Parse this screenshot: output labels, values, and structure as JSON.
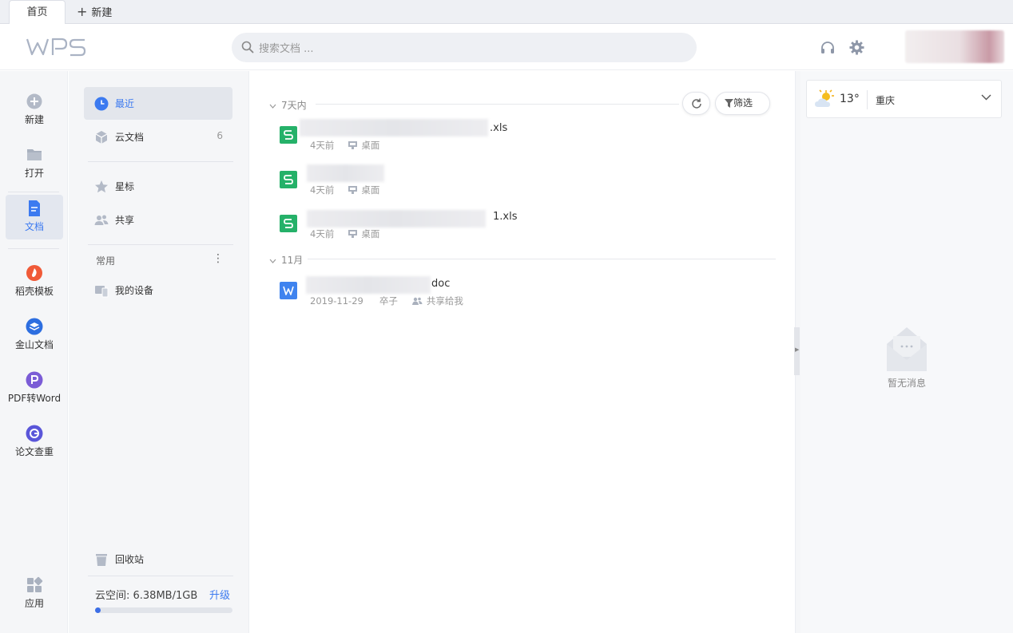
{
  "tabs": {
    "home": "首页",
    "new": "新建"
  },
  "search": {
    "placeholder": "搜索文档 ..."
  },
  "leftnav": {
    "new": "新建",
    "open": "打开",
    "docs": "文档",
    "template": "稻壳模板",
    "kdocs": "金山文档",
    "pdf2word": "PDF转Word",
    "paper_check": "论文查重",
    "apps": "应用"
  },
  "sidebar": {
    "recent": "最近",
    "cloud_docs": "云文档",
    "cloud_docs_count": "6",
    "starred": "星标",
    "shared": "共享",
    "section_common": "常用",
    "my_devices": "我的设备",
    "recycle": "回收站",
    "storage_label": "云空间: 6.38MB/1GB",
    "storage_used_fraction": 0.006,
    "upgrade": "升级"
  },
  "main": {
    "group_recent": "7天内",
    "group_nov": "11月",
    "filter": "筛选",
    "files": [
      {
        "name_suffix": ".xls",
        "time": "4天前",
        "location": "桌面",
        "type": "et"
      },
      {
        "name_suffix": "",
        "time": "4天前",
        "location": "桌面",
        "type": "et"
      },
      {
        "name_suffix": "1.xls",
        "time": "4天前",
        "location": "桌面",
        "type": "et"
      },
      {
        "name_suffix": "doc",
        "time": "2019-11-29",
        "owner": "卒子",
        "location": "共享给我",
        "type": "wps"
      }
    ]
  },
  "right": {
    "temp": "13°",
    "city": "重庆",
    "empty_msg": "暂无消息"
  },
  "colors": {
    "accent": "#3c7af0",
    "spreadsheet": "#25b169",
    "writer": "#3f83ef"
  }
}
